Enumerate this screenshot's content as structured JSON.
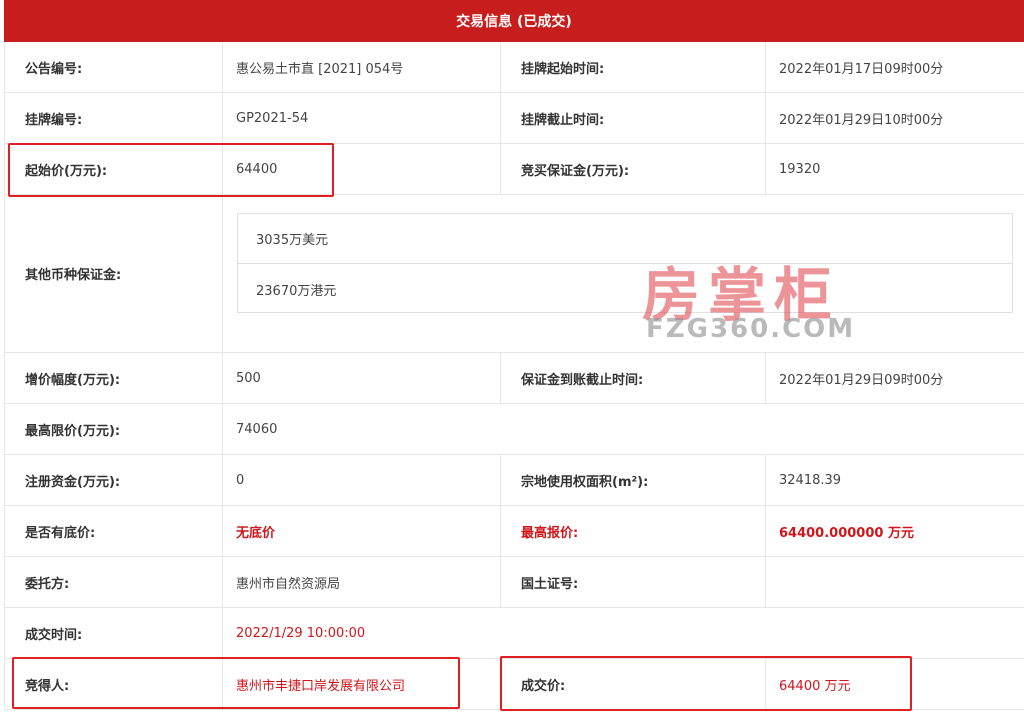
{
  "header": {
    "title": "交易信息 (已成交)"
  },
  "rows": [
    {
      "l1": "公告编号:",
      "v1": "惠公易土市直 [2021] 054号",
      "l2": "挂牌起始时间:",
      "v2": "2022年01月17日09时00分"
    },
    {
      "l1": "挂牌编号:",
      "v1": "GP2021-54",
      "l2": "挂牌截止时间:",
      "v2": "2022年01月29日10时00分"
    },
    {
      "l1": "起始价(万元):",
      "v1": "64400",
      "l2": "竞买保证金(万元):",
      "v2": "19320"
    },
    {
      "l1": "其他币种保证金:",
      "sub": [
        "3035万美元",
        "23670万港元"
      ]
    },
    {
      "l1": "增价幅度(万元):",
      "v1": "500",
      "l2": "保证金到账截止时间:",
      "v2": "2022年01月29日09时00分"
    },
    {
      "l1": "最高限价(万元):",
      "v1": "74060"
    },
    {
      "l1": "注册资金(万元):",
      "v1": "0",
      "l2": "宗地使用权面积(m²):",
      "v2": "32418.39"
    },
    {
      "l1": "是否有底价:",
      "v1": "无底价",
      "l2": "最高报价:",
      "v2": "64400.000000 万元"
    },
    {
      "l1": "委托方:",
      "v1": "惠州市自然资源局",
      "l2": "国土证号:",
      "v2": ""
    },
    {
      "l1": "成交时间:",
      "v1": "2022/1/29 10:00:00"
    },
    {
      "l1": "竞得人:",
      "v1": "惠州市丰捷口岸发展有限公司",
      "l2": "成交价:",
      "v2": "64400 万元"
    }
  ],
  "watermark": {
    "cn": "房掌柜",
    "en": "FZG360.COM"
  },
  "colors": {
    "header_bg": "#c81d1d",
    "highlight": "#e02020",
    "red_text": "#d0161b"
  }
}
